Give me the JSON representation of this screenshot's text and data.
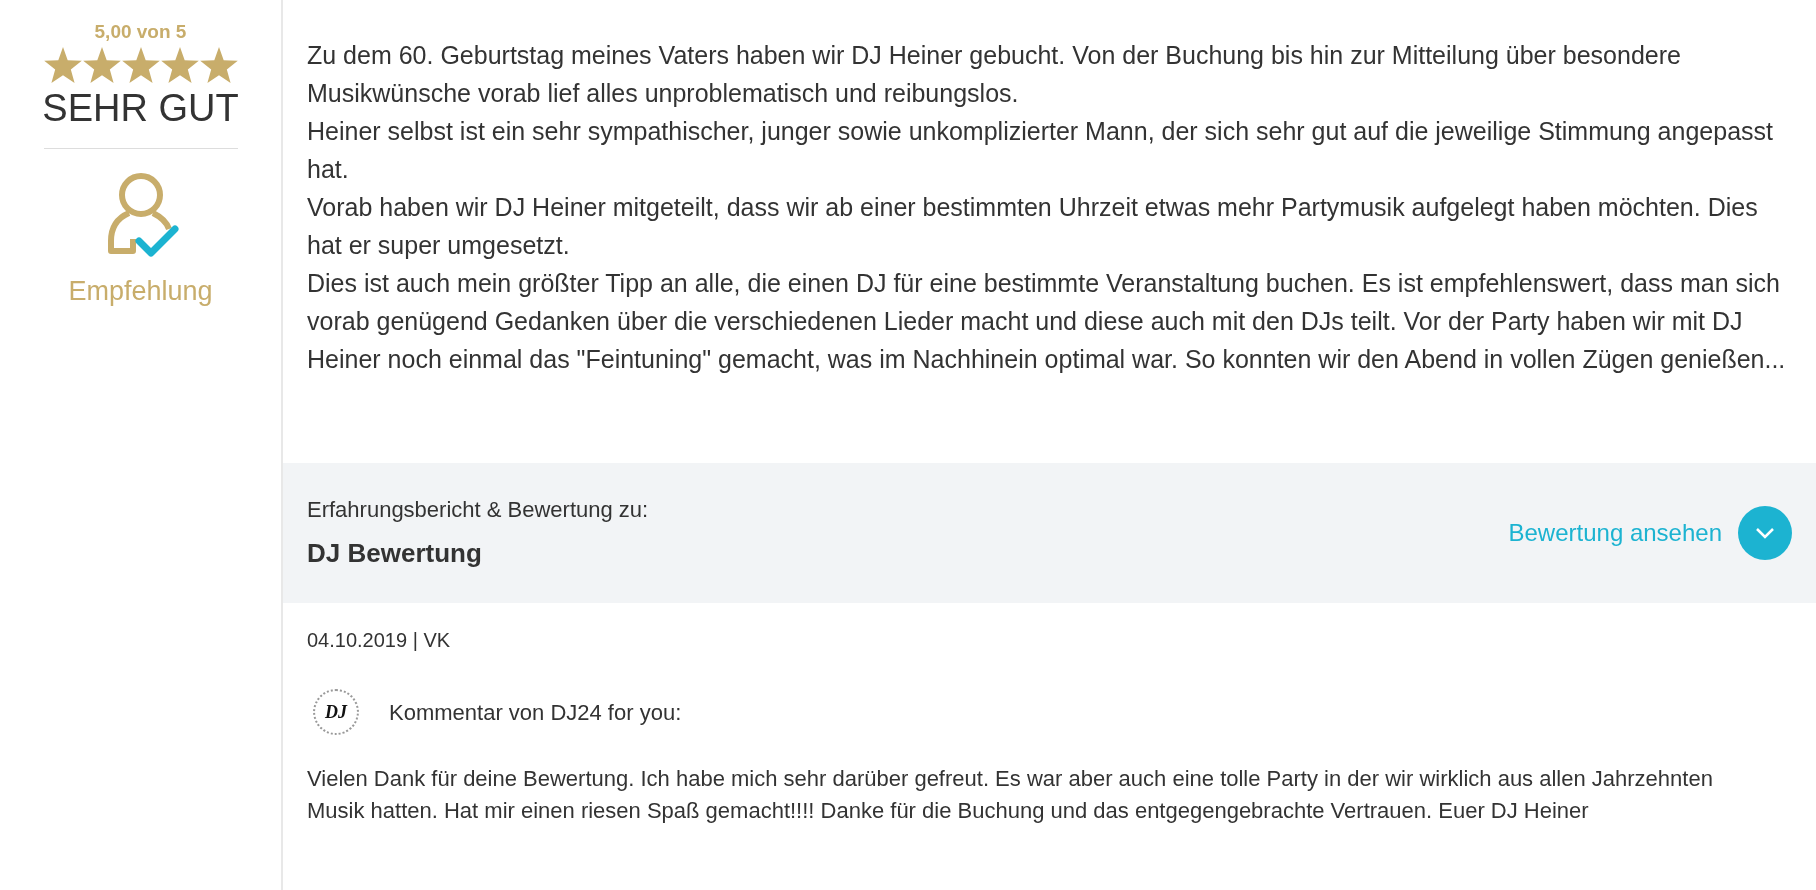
{
  "rating": {
    "score": "5,00 von 5",
    "stars": 5,
    "verdict": "SEHR GUT",
    "badge": "Empfehlung"
  },
  "review": {
    "paragraphs": [
      "Zu dem 60. Geburtstag meines Vaters haben wir DJ Heiner gebucht. Von der Buchung bis hin zur Mitteilung über besondere Musikwünsche vorab lief alles unproblematisch und reibungslos.",
      "Heiner selbst ist ein sehr sympathischer, junger sowie unkomplizierter Mann, der sich sehr gut auf die jeweilige Stimmung angepasst hat.",
      "Vorab haben wir DJ Heiner mitgeteilt, dass wir ab einer bestimmten Uhrzeit etwas mehr Partymusik aufgelegt haben möchten. Dies hat er super umgesetzt.",
      "Dies ist auch mein größter Tipp an alle, die einen DJ für eine bestimmte Veranstaltung buchen. Es ist empfehlenswert, dass man sich vorab genügend Gedanken über die verschiedenen Lieder macht und diese auch mit den DJs teilt. Vor der Party haben wir mit DJ Heiner noch einmal das \"Feintuning\" gemacht, was im Nachhinein optimal war. So konnten wir den Abend in vollen Zügen genießen..."
    ]
  },
  "subject": {
    "label": "Erfahrungsbericht & Bewertung zu:",
    "title": "DJ Bewertung",
    "link": "Bewertung ansehen",
    "expanded": false
  },
  "meta": "04.10.2019 | VK",
  "comment": {
    "logo_text": "DJ",
    "heading": "Kommentar von DJ24 for you:",
    "text": "Vielen Dank für deine Bewertung. Ich habe mich sehr darüber gefreut. Es war aber auch eine tolle Party in der wir wirklich aus allen Jahrzehnten Musik hatten. Hat mir einen riesen Spaß gemacht!!!! Danke für die Buchung und das entgegengebrachte Vertrauen. Euer DJ Heiner"
  }
}
